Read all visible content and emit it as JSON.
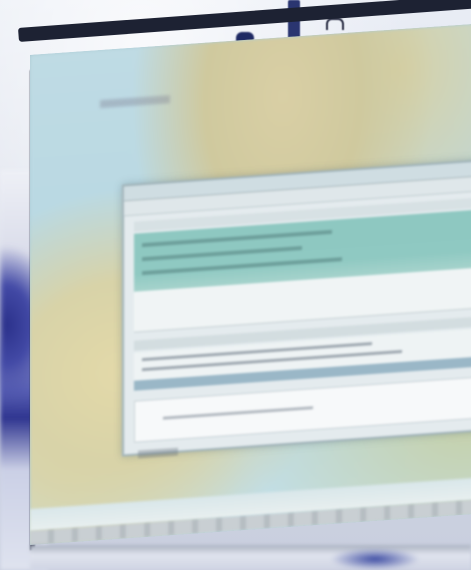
{
  "scene": {
    "description_label": "",
    "colors": {
      "wall": "#d7dbe6",
      "frame": "#1d2233",
      "sea": "#b8d8e2",
      "land": "#d9cfa5",
      "dialog_bg": "#e4ebee",
      "selection": "#8ec8c1",
      "banner_accent": "#2f3590"
    }
  },
  "dialog": {
    "title": "",
    "list_rows": 3
  },
  "icons": {
    "clip": "clip-icon",
    "hook": "hook-icon"
  }
}
